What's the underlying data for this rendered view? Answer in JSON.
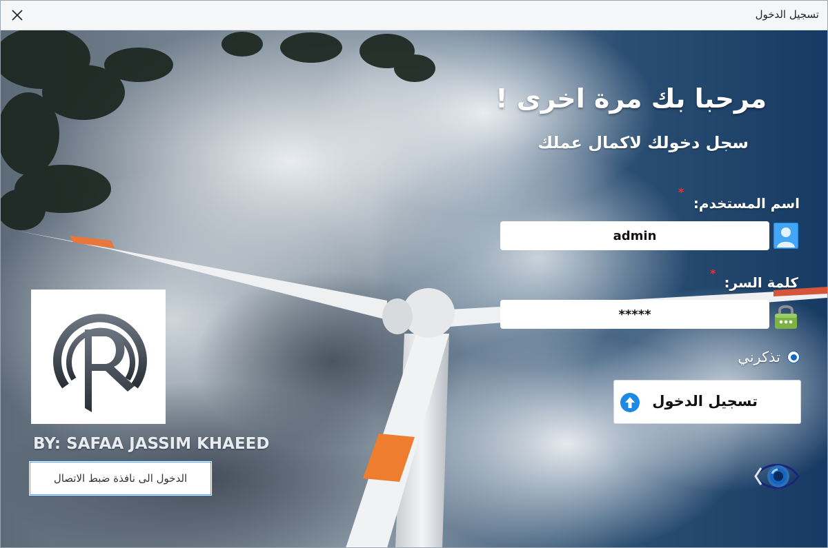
{
  "window": {
    "title": "تسجيل الدخول"
  },
  "header": {
    "welcome": "مرحبا بك مرة اخرى !",
    "subtitle": "سجل دخولك لاكمال عملك"
  },
  "form": {
    "username_label": "اسم المستخدم:",
    "username_value": "admin",
    "password_label": "كلمة السر:",
    "password_value": "*****",
    "required_mark": "*",
    "remember_label": "تذكرني",
    "remember_checked": true,
    "login_label": "تسجيل الدخول"
  },
  "footer": {
    "author": "BY: SAFAA JASSIM KHAEED",
    "connection_button": "الدخول الى نافذة ضبط الاتصال"
  },
  "icons": {
    "close": "close-icon",
    "user": "user-icon",
    "lock": "lock-icon",
    "login": "arrow-up-icon",
    "eye": "eye-icon",
    "logo": "r-logo"
  },
  "colors": {
    "required": "#ff2a2a",
    "accent": "#1565c0",
    "field_bg": "#ffffff"
  }
}
